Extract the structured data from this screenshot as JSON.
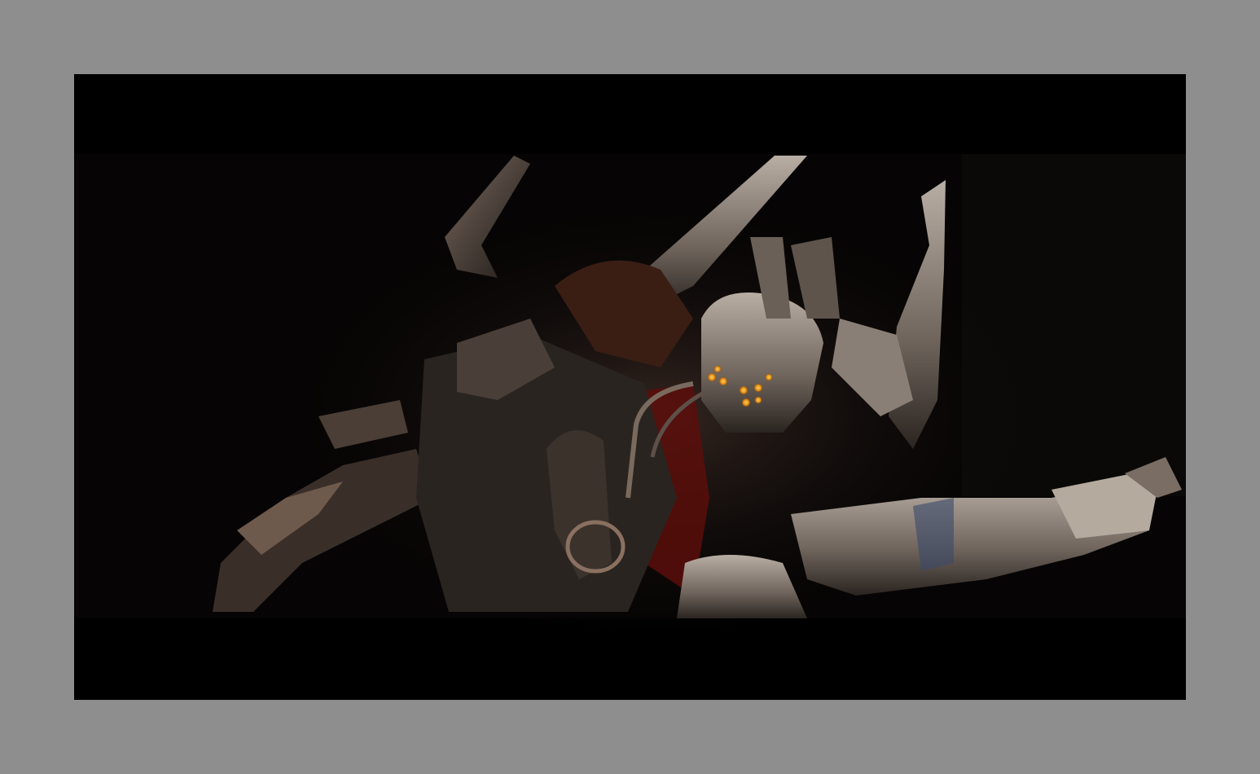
{
  "frame": {
    "border_color": "#8e8e8e",
    "matte_color": "#000000"
  },
  "scene": {
    "subject_icon": "armored-alien-icon",
    "eye_color": "#f0a020",
    "armor_color": "#9a8f86",
    "cloth_color": "#8a1a14"
  }
}
